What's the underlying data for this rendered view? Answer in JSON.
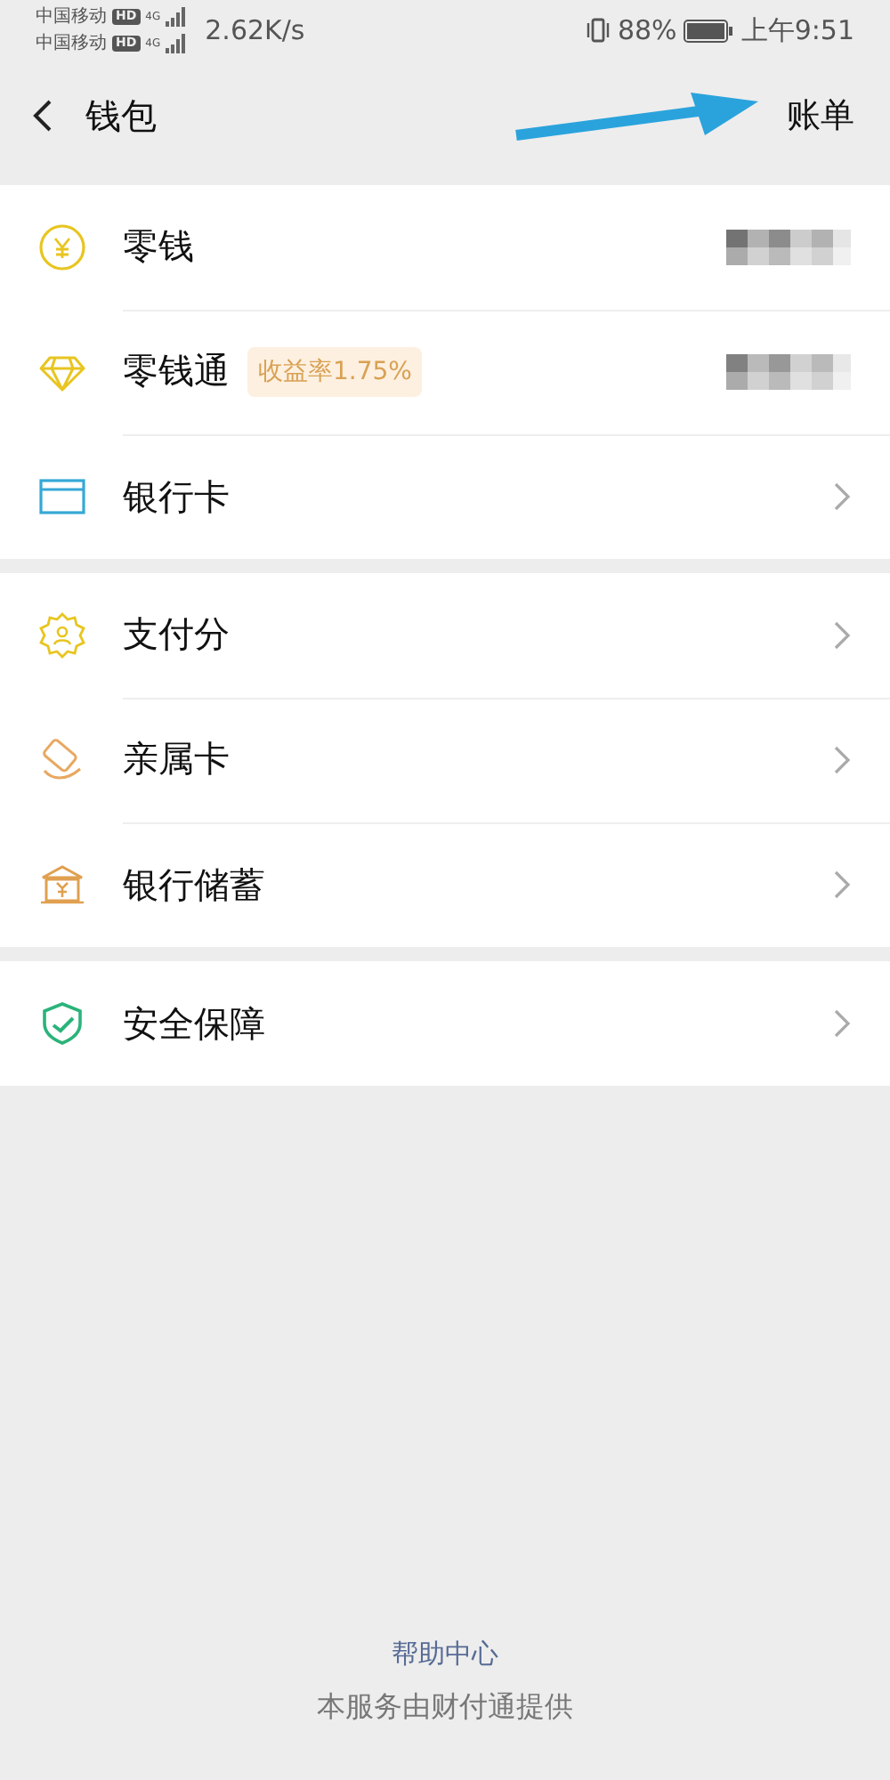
{
  "status_bar": {
    "carriers": [
      {
        "name": "中国移动",
        "badge": "HD",
        "network": "4G"
      },
      {
        "name": "中国移动",
        "badge": "HD",
        "network": "4G"
      }
    ],
    "speed": "2.62K/s",
    "battery": "88%",
    "time": "上午9:51"
  },
  "nav": {
    "title": "钱包",
    "action": "账单"
  },
  "groups": [
    {
      "rows": [
        {
          "label": "零钱",
          "kind": "amount"
        },
        {
          "label": "零钱通",
          "tag": "收益率1.75%",
          "kind": "amount"
        },
        {
          "label": "银行卡",
          "kind": "chevron"
        }
      ]
    },
    {
      "rows": [
        {
          "label": "支付分",
          "kind": "chevron"
        },
        {
          "label": "亲属卡",
          "kind": "chevron"
        },
        {
          "label": "银行储蓄",
          "kind": "chevron"
        }
      ]
    },
    {
      "rows": [
        {
          "label": "安全保障",
          "kind": "chevron"
        }
      ]
    }
  ],
  "footer": {
    "link": "帮助中心",
    "note": "本服务由财付通提供"
  }
}
